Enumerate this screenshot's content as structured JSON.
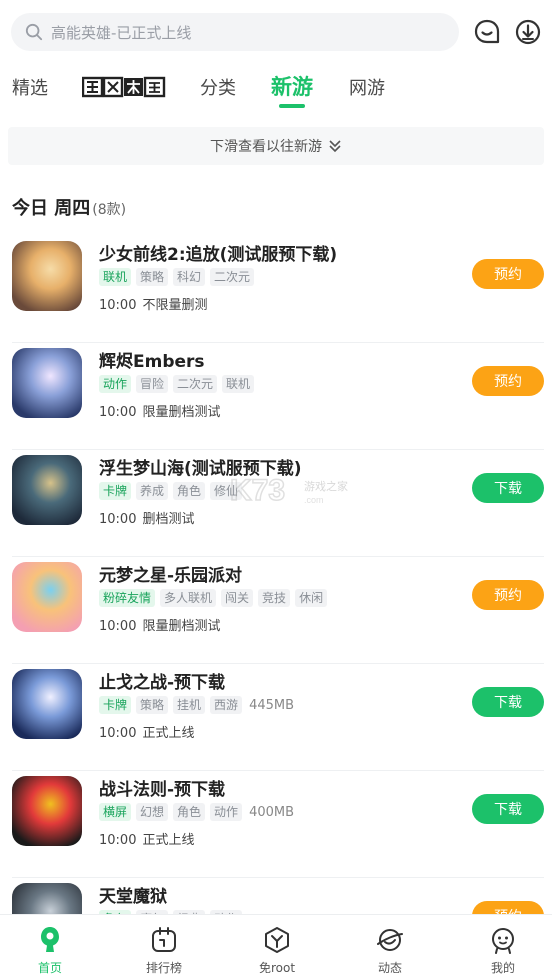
{
  "search": {
    "placeholder": "高能英雄-已正式上线"
  },
  "tabs": [
    {
      "label": "精选",
      "active": false
    },
    {
      "label": "暗区突围",
      "active": false,
      "logo": true
    },
    {
      "label": "分类",
      "active": false
    },
    {
      "label": "新游",
      "active": true
    },
    {
      "label": "网游",
      "active": false
    }
  ],
  "notice": {
    "text": "下滑查看以往新游"
  },
  "day": {
    "title": "今日 周四",
    "count": "(8款)"
  },
  "games": [
    {
      "name": "少女前线2:追放(测试服预下载)",
      "tags": [
        "联机",
        "策略",
        "科幻",
        "二次元"
      ],
      "size": "",
      "time": "10:00",
      "status": "不限量删测",
      "button": "预约",
      "button_type": "reserve"
    },
    {
      "name": "辉烬Embers",
      "tags": [
        "动作",
        "冒险",
        "二次元",
        "联机"
      ],
      "size": "",
      "time": "10:00",
      "status": "限量删档测试",
      "button": "预约",
      "button_type": "reserve"
    },
    {
      "name": "浮生梦山海(测试服预下载)",
      "tags": [
        "卡牌",
        "养成",
        "角色",
        "修仙"
      ],
      "size": "",
      "time": "10:00",
      "status": "删档测试",
      "button": "下载",
      "button_type": "download"
    },
    {
      "name": "元梦之星-乐园派对",
      "tags": [
        "粉碎友情",
        "多人联机",
        "闯关",
        "竞技",
        "休闲"
      ],
      "size": "",
      "time": "10:00",
      "status": "限量删档测试",
      "button": "预约",
      "button_type": "reserve"
    },
    {
      "name": "止戈之战-预下载",
      "tags": [
        "卡牌",
        "策略",
        "挂机",
        "西游"
      ],
      "size": "445MB",
      "time": "10:00",
      "status": "正式上线",
      "button": "下载",
      "button_type": "download"
    },
    {
      "name": "战斗法则-预下载",
      "tags": [
        "横屏",
        "幻想",
        "角色",
        "动作"
      ],
      "size": "400MB",
      "time": "10:00",
      "status": "正式上线",
      "button": "下载",
      "button_type": "download"
    },
    {
      "name": "天堂魔狱",
      "tags": [
        "角色",
        "魔幻",
        "经典",
        "动作"
      ],
      "size": "",
      "time": "",
      "status": "",
      "button": "预约",
      "button_type": "reserve"
    }
  ],
  "bottom_nav": [
    {
      "label": "首页",
      "icon": "home-icon",
      "active": true
    },
    {
      "label": "排行榜",
      "icon": "ranking-icon",
      "active": false
    },
    {
      "label": "免root",
      "icon": "noroot-icon",
      "active": false
    },
    {
      "label": "动态",
      "icon": "feed-icon",
      "active": false
    },
    {
      "label": "我的",
      "icon": "profile-icon",
      "active": false
    }
  ],
  "colors": {
    "accent": "#1cc16a",
    "reserve": "#fca315",
    "download": "#1cc16a"
  }
}
